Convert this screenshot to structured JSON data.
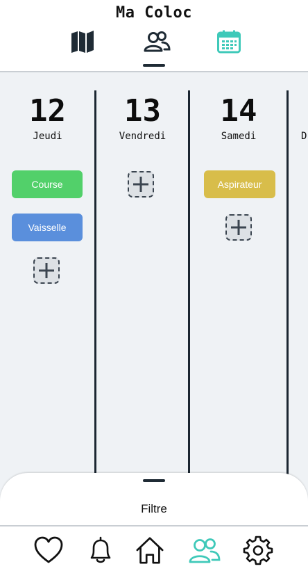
{
  "header": {
    "title": "Ma Coloc",
    "icons": [
      "map-icon",
      "users-icon",
      "calendar-icon"
    ],
    "active_tab": "users-icon"
  },
  "colors": {
    "accent": "#3fc9b9",
    "dark": "#1f2b35",
    "task_green": "#52d06a",
    "task_blue": "#5a8fdc",
    "task_yellow": "#d8bd4a"
  },
  "days": [
    {
      "number": "12",
      "name": "Jeudi",
      "tasks": [
        "Course",
        "Vaisselle"
      ]
    },
    {
      "number": "13",
      "name": "Vendredi",
      "tasks": []
    },
    {
      "number": "14",
      "name": "Samedi",
      "tasks": [
        "Aspirateur"
      ]
    },
    {
      "number": "",
      "name": "D",
      "tasks": []
    }
  ],
  "filter": {
    "label": "Filtre"
  },
  "bottom_nav": {
    "icons": [
      "heart-icon",
      "bell-icon",
      "home-icon",
      "users-icon",
      "gear-icon"
    ],
    "active": "users-icon"
  }
}
